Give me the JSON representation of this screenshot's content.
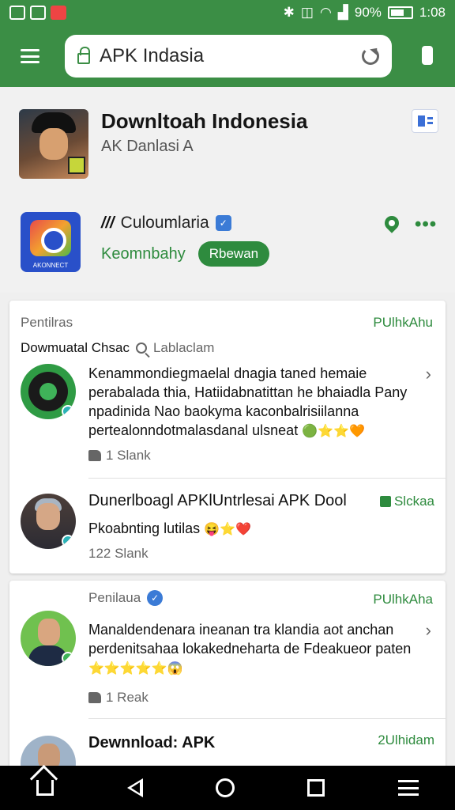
{
  "status": {
    "battery": "90%",
    "time": "1:08"
  },
  "browser": {
    "url": "APK Indasia"
  },
  "header": {
    "title": "Downltoah Indonesia",
    "subtitle": "AK Danlasi A"
  },
  "app": {
    "icon_label": "AKONNECT",
    "name_prefix": "///",
    "name": "Culoumlaria",
    "verified_glyph": "✓",
    "subtitle": "Keomnbahy",
    "button": "Rbewan",
    "more_glyph": "•••"
  },
  "card1": {
    "heading": "Pentilras",
    "heading_right": "PUlhkAhu",
    "subheading": "Dowmuatal Chsac",
    "subheading_note": "Lablaclam",
    "review1": {
      "text": "Kenammondiegmaelal dnagia taned hemaie perabalada thia, Hatiidabnatittan he bhaiadla Pany npadinida Nao baokyma kaconbalrisiilanna pertealonndotmalasdanal ulsneat",
      "emoji": "🟢⭐⭐🧡",
      "chevron": "›",
      "likes": "1 Slank"
    },
    "entry2": {
      "title": "Dunerlboagl APKlUntrlesai APK Dool",
      "tag": "Slckaa",
      "text": "Pkoabnting lutilas",
      "emoji": "😝⭐❤️",
      "likes": "122 Slank"
    }
  },
  "card2": {
    "heading": "Penilaua",
    "heading_right": "PUlhkAha",
    "review": {
      "text": "Manaldendenara ineanan tra klandia aot anchan perdenitsahaa lokakedneharta de Fdeakueor paten",
      "emoji": "⭐⭐⭐⭐⭐😱",
      "chevron": "›",
      "likes": "1 Reak"
    },
    "entry": {
      "title": "Dewnnload: APK",
      "tag": "2Ulhidam"
    }
  }
}
